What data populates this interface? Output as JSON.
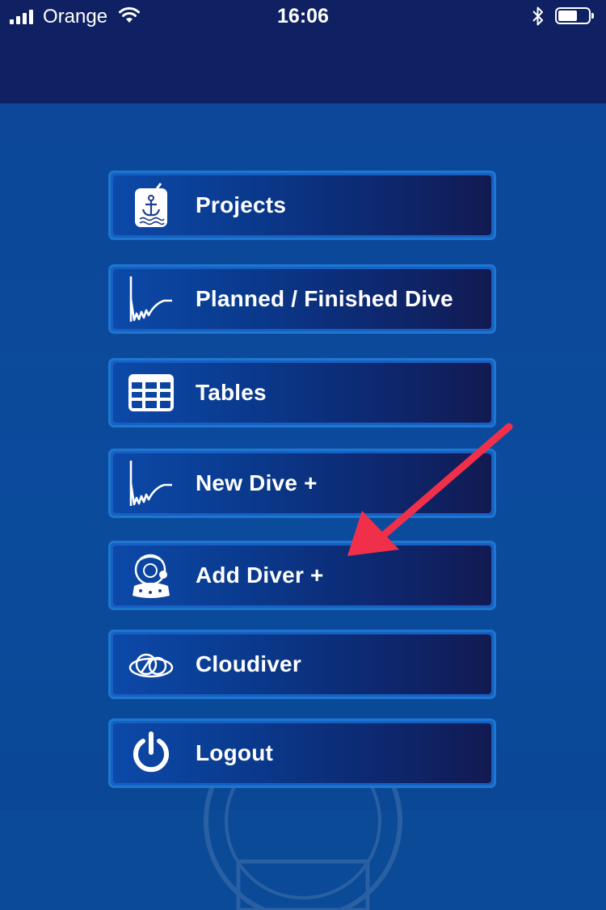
{
  "status_bar": {
    "carrier": "Orange",
    "time": "16:06",
    "battery_level": 0.65
  },
  "menu": [
    {
      "label": "Projects",
      "icon": "anchor-document-icon"
    },
    {
      "label": "Planned / Finished Dive",
      "icon": "dive-profile-icon"
    },
    {
      "label": "Tables",
      "icon": "table-grid-icon"
    },
    {
      "label": "New Dive +",
      "icon": "dive-profile-icon"
    },
    {
      "label": "Add Diver +",
      "icon": "diver-helmet-icon"
    },
    {
      "label": "Cloudiver",
      "icon": "cloud-icon"
    },
    {
      "label": "Logout",
      "icon": "power-icon"
    }
  ],
  "colors": {
    "status_bar_bg": "#0f2162",
    "main_bg": "#0b4a97",
    "button_border": "#1f76cf",
    "annotation_arrow": "#f0304a"
  }
}
